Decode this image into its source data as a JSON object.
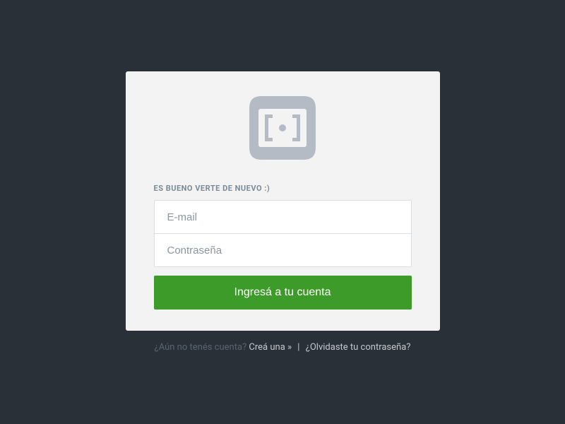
{
  "form": {
    "heading": "ES BUENO VERTE DE NUEVO :)",
    "email_placeholder": "E-mail",
    "password_placeholder": "Contraseña",
    "submit_label": "Ingresá a tu cuenta"
  },
  "footer": {
    "no_account_text": "¿Aún no tenés cuenta? ",
    "create_link": "Creá una »",
    "separator": " | ",
    "forgot_password_link": "¿Olvidaste tu contraseña?"
  }
}
